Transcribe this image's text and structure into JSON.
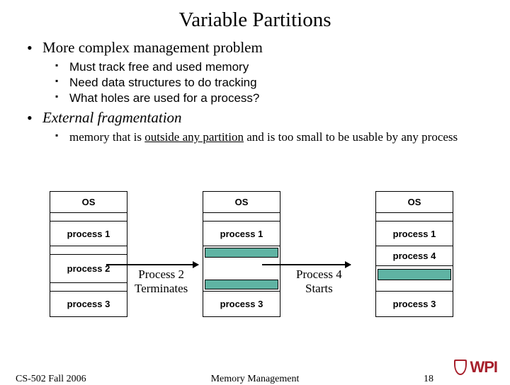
{
  "title": "Variable Partitions",
  "bullets": {
    "b1": "More complex management problem",
    "b1_subs": {
      "s1": "Must track free and used memory",
      "s2": "Need data structures to do tracking",
      "s3": "What holes are used for a process?"
    },
    "b2": "External fragmentation",
    "b2_subs": {
      "s1_pre": "memory that is ",
      "s1_u": "outside any partition",
      "s1_post": " and is too small to be usable by any process"
    }
  },
  "diagram": {
    "col1": {
      "os": "OS",
      "p1": "process 1",
      "p2": "process 2",
      "p3": "process 3"
    },
    "label1a": "Process 2",
    "label1b": "Terminates",
    "col2": {
      "os": "OS",
      "p1": "process 1",
      "p3": "process 3"
    },
    "label2a": "Process 4",
    "label2b": "Starts",
    "col3": {
      "os": "OS",
      "p1": "process 1",
      "p4": "process 4",
      "p3": "process 3"
    }
  },
  "footer": {
    "left": "CS-502 Fall 2006",
    "center": "Memory Management",
    "pagenum": "18",
    "logo": "WPI"
  }
}
